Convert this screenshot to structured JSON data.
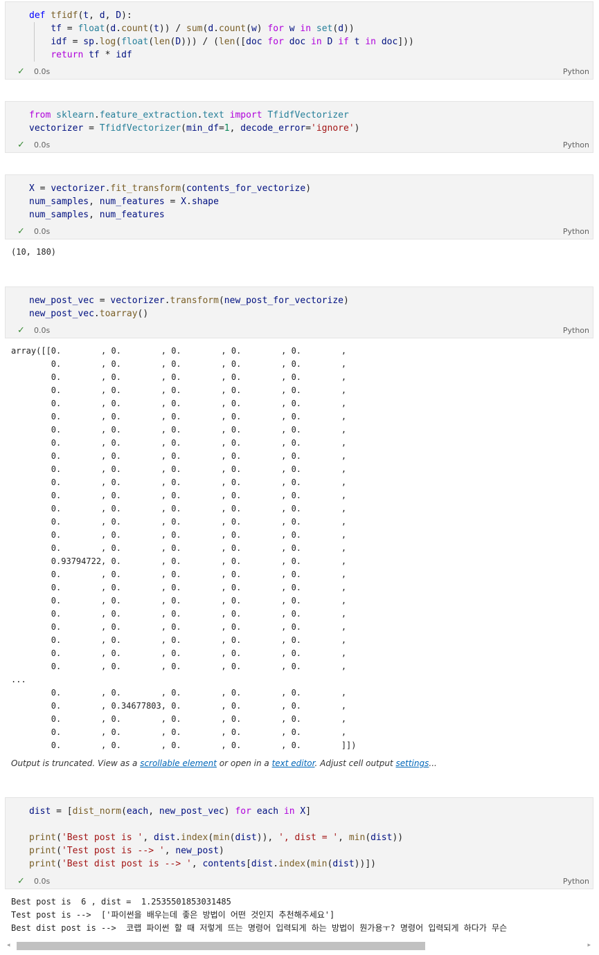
{
  "cells": [
    {
      "lines": [
        [
          [
            "def",
            "def"
          ],
          [
            "fn",
            " tfidf"
          ],
          [
            "",
            "("
          ],
          [
            "var",
            "t"
          ],
          [
            "",
            ", "
          ],
          [
            "var",
            "d"
          ],
          [
            "",
            ", "
          ],
          [
            "var",
            "D"
          ],
          [
            "",
            "):"
          ]
        ],
        [
          [
            "",
            "    "
          ],
          [
            "var",
            "tf"
          ],
          [
            "",
            " = "
          ],
          [
            "cls",
            "float"
          ],
          [
            "",
            "("
          ],
          [
            "var",
            "d"
          ],
          [
            "",
            "."
          ],
          [
            "fn",
            "count"
          ],
          [
            "",
            "("
          ],
          [
            "var",
            "t"
          ],
          [
            "",
            "))"
          ],
          [
            "",
            " / "
          ],
          [
            "fn",
            "sum"
          ],
          [
            "",
            "("
          ],
          [
            "var",
            "d"
          ],
          [
            "",
            "."
          ],
          [
            "fn",
            "count"
          ],
          [
            "",
            "("
          ],
          [
            "var",
            "w"
          ],
          [
            "",
            ")"
          ],
          [
            "kw",
            " for"
          ],
          [
            "var",
            " w"
          ],
          [
            "kw",
            " in"
          ],
          [
            "cls",
            " set"
          ],
          [
            "",
            "("
          ],
          [
            "var",
            "d"
          ],
          [
            "",
            "))"
          ]
        ],
        [
          [
            "",
            "    "
          ],
          [
            "var",
            "idf"
          ],
          [
            "",
            " = "
          ],
          [
            "var",
            "sp"
          ],
          [
            "",
            "."
          ],
          [
            "fn",
            "log"
          ],
          [
            "",
            "("
          ],
          [
            "cls",
            "float"
          ],
          [
            "",
            "("
          ],
          [
            "fn",
            "len"
          ],
          [
            "",
            "("
          ],
          [
            "var",
            "D"
          ],
          [
            "",
            ")))"
          ],
          [
            "",
            " / "
          ],
          [
            "",
            "("
          ],
          [
            "fn",
            "len"
          ],
          [
            "",
            "(["
          ],
          [
            "var",
            "doc"
          ],
          [
            "kw",
            " for"
          ],
          [
            "var",
            " doc"
          ],
          [
            "kw",
            " in"
          ],
          [
            "var",
            " D"
          ],
          [
            "kw",
            " if"
          ],
          [
            "var",
            " t"
          ],
          [
            "kw",
            " in"
          ],
          [
            "var",
            " doc"
          ],
          [
            "",
            "]))"
          ]
        ],
        [
          [
            "",
            "    "
          ],
          [
            "kw",
            "return"
          ],
          [
            "var",
            " tf"
          ],
          [
            "",
            " * "
          ],
          [
            "var",
            "idf"
          ]
        ]
      ],
      "status": "✓",
      "time": "0.0s",
      "language": "Python"
    },
    {
      "lines": [
        [
          [
            "kw",
            "from"
          ],
          [
            "cls",
            " sklearn"
          ],
          [
            "",
            "."
          ],
          [
            "cls",
            "feature_extraction"
          ],
          [
            "",
            "."
          ],
          [
            "cls",
            "text"
          ],
          [
            "kw",
            " import"
          ],
          [
            "cls",
            " TfidfVectorizer"
          ]
        ],
        [
          [
            "var",
            "vectorizer"
          ],
          [
            "",
            " = "
          ],
          [
            "cls",
            "TfidfVectorizer"
          ],
          [
            "",
            "("
          ],
          [
            "var",
            "min_df"
          ],
          [
            "",
            "="
          ],
          [
            "num",
            "1"
          ],
          [
            "",
            ", "
          ],
          [
            "var",
            "decode_error"
          ],
          [
            "",
            "="
          ],
          [
            "str",
            "'ignore'"
          ],
          [
            "",
            ")"
          ]
        ]
      ],
      "status": "✓",
      "time": "0.0s",
      "language": "Python"
    },
    {
      "lines": [
        [
          [
            "var",
            "X"
          ],
          [
            "",
            " = "
          ],
          [
            "var",
            "vectorizer"
          ],
          [
            "",
            "."
          ],
          [
            "fn",
            "fit_transform"
          ],
          [
            "",
            "("
          ],
          [
            "var",
            "contents_for_vectorize"
          ],
          [
            "",
            ")"
          ]
        ],
        [
          [
            "var",
            "num_samples"
          ],
          [
            "",
            ", "
          ],
          [
            "var",
            "num_features"
          ],
          [
            "",
            " = "
          ],
          [
            "var",
            "X"
          ],
          [
            "",
            "."
          ],
          [
            "var",
            "shape"
          ]
        ],
        [
          [
            "var",
            "num_samples"
          ],
          [
            "",
            ", "
          ],
          [
            "var",
            "num_features"
          ]
        ]
      ],
      "status": "✓",
      "time": "0.0s",
      "language": "Python"
    },
    {
      "lines": [
        [
          [
            "var",
            "new_post_vec"
          ],
          [
            "",
            " = "
          ],
          [
            "var",
            "vectorizer"
          ],
          [
            "",
            "."
          ],
          [
            "fn",
            "transform"
          ],
          [
            "",
            "("
          ],
          [
            "var",
            "new_post_for_vectorize"
          ],
          [
            "",
            ")"
          ]
        ],
        [
          [
            "var",
            "new_post_vec"
          ],
          [
            "",
            "."
          ],
          [
            "fn",
            "toarray"
          ],
          [
            "",
            "()"
          ]
        ]
      ],
      "status": "✓",
      "time": "0.0s",
      "language": "Python"
    },
    {
      "lines": [
        [
          [
            "var",
            "dist"
          ],
          [
            "",
            " = "
          ],
          [
            "",
            "["
          ],
          [
            "fn",
            "dist_norm"
          ],
          [
            "",
            "("
          ],
          [
            "var",
            "each"
          ],
          [
            "",
            ", "
          ],
          [
            "var",
            "new_post_vec"
          ],
          [
            "",
            ")"
          ],
          [
            "kw",
            " for"
          ],
          [
            "var",
            " each"
          ],
          [
            "kw",
            " in"
          ],
          [
            "var",
            " X"
          ],
          [
            "",
            "]"
          ]
        ],
        [
          [
            "",
            ""
          ]
        ],
        [
          [
            "fn",
            "print"
          ],
          [
            "",
            "("
          ],
          [
            "str",
            "'Best post is '"
          ],
          [
            "",
            ", "
          ],
          [
            "var",
            "dist"
          ],
          [
            "",
            "."
          ],
          [
            "fn",
            "index"
          ],
          [
            "",
            "("
          ],
          [
            "fn",
            "min"
          ],
          [
            "",
            "("
          ],
          [
            "var",
            "dist"
          ],
          [
            "",
            "))"
          ],
          [
            "",
            ", "
          ],
          [
            "str",
            "', dist = '"
          ],
          [
            "",
            ", "
          ],
          [
            "fn",
            "min"
          ],
          [
            "",
            "("
          ],
          [
            "var",
            "dist"
          ],
          [
            "",
            "))"
          ]
        ],
        [
          [
            "fn",
            "print"
          ],
          [
            "",
            "("
          ],
          [
            "str",
            "'Test post is --> '"
          ],
          [
            "",
            ", "
          ],
          [
            "var",
            "new_post"
          ],
          [
            "",
            ")"
          ]
        ],
        [
          [
            "fn",
            "print"
          ],
          [
            "",
            "("
          ],
          [
            "str",
            "'Best dist post is --> '"
          ],
          [
            "",
            ", "
          ],
          [
            "var",
            "contents"
          ],
          [
            "",
            "["
          ],
          [
            "var",
            "dist"
          ],
          [
            "",
            "."
          ],
          [
            "fn",
            "index"
          ],
          [
            "",
            "("
          ],
          [
            "fn",
            "min"
          ],
          [
            "",
            "("
          ],
          [
            "var",
            "dist"
          ],
          [
            "",
            ")"
          ],
          [
            "",
            ")"
          ],
          [
            "",
            "])"
          ]
        ]
      ],
      "status": "✓",
      "time": "0.0s",
      "language": "Python"
    }
  ],
  "outputs": {
    "shape": "(10, 180)",
    "array_lines": [
      "array([[0.        , 0.        , 0.        , 0.        , 0.        ,",
      "        0.        , 0.        , 0.        , 0.        , 0.        ,",
      "        0.        , 0.        , 0.        , 0.        , 0.        ,",
      "        0.        , 0.        , 0.        , 0.        , 0.        ,",
      "        0.        , 0.        , 0.        , 0.        , 0.        ,",
      "        0.        , 0.        , 0.        , 0.        , 0.        ,",
      "        0.        , 0.        , 0.        , 0.        , 0.        ,",
      "        0.        , 0.        , 0.        , 0.        , 0.        ,",
      "        0.        , 0.        , 0.        , 0.        , 0.        ,",
      "        0.        , 0.        , 0.        , 0.        , 0.        ,",
      "        0.        , 0.        , 0.        , 0.        , 0.        ,",
      "        0.        , 0.        , 0.        , 0.        , 0.        ,",
      "        0.        , 0.        , 0.        , 0.        , 0.        ,",
      "        0.        , 0.        , 0.        , 0.        , 0.        ,",
      "        0.        , 0.        , 0.        , 0.        , 0.        ,",
      "        0.        , 0.        , 0.        , 0.        , 0.        ,",
      "        0.93794722, 0.        , 0.        , 0.        , 0.        ,",
      "        0.        , 0.        , 0.        , 0.        , 0.        ,",
      "        0.        , 0.        , 0.        , 0.        , 0.        ,",
      "        0.        , 0.        , 0.        , 0.        , 0.        ,",
      "        0.        , 0.        , 0.        , 0.        , 0.        ,",
      "        0.        , 0.        , 0.        , 0.        , 0.        ,",
      "        0.        , 0.        , 0.        , 0.        , 0.        ,",
      "        0.        , 0.        , 0.        , 0.        , 0.        ,",
      "        0.        , 0.        , 0.        , 0.        , 0.        ,",
      "...",
      "        0.        , 0.        , 0.        , 0.        , 0.        ,",
      "        0.        , 0.34677803, 0.        , 0.        , 0.        ,",
      "        0.        , 0.        , 0.        , 0.        , 0.        ,",
      "        0.        , 0.        , 0.        , 0.        , 0.        ,",
      "        0.        , 0.        , 0.        , 0.        , 0.        ]])"
    ],
    "truncated": {
      "prefix": "Output is truncated. View as a ",
      "link1": "scrollable element",
      "middle": " or open in a ",
      "link2": "text editor",
      "middle2": ". Adjust cell output ",
      "link3": "settings",
      "suffix": "..."
    },
    "print_lines": [
      "Best post is  6 , dist =  1.2535501853031485",
      "Test post is -->  ['파이썬을 배우는데 좋은 방법이 어떤 것인지 추천해주세요']",
      "Best dist post is -->  코랩 파이썬 할 때 저렇게 뜨는 명령어 입력되게 하는 방법이 뭔가용ㅜ? 명령어 입력되게 하다가 무슨"
    ]
  },
  "scrollbar": {
    "left_arrow": "◂",
    "right_arrow": "▸"
  }
}
